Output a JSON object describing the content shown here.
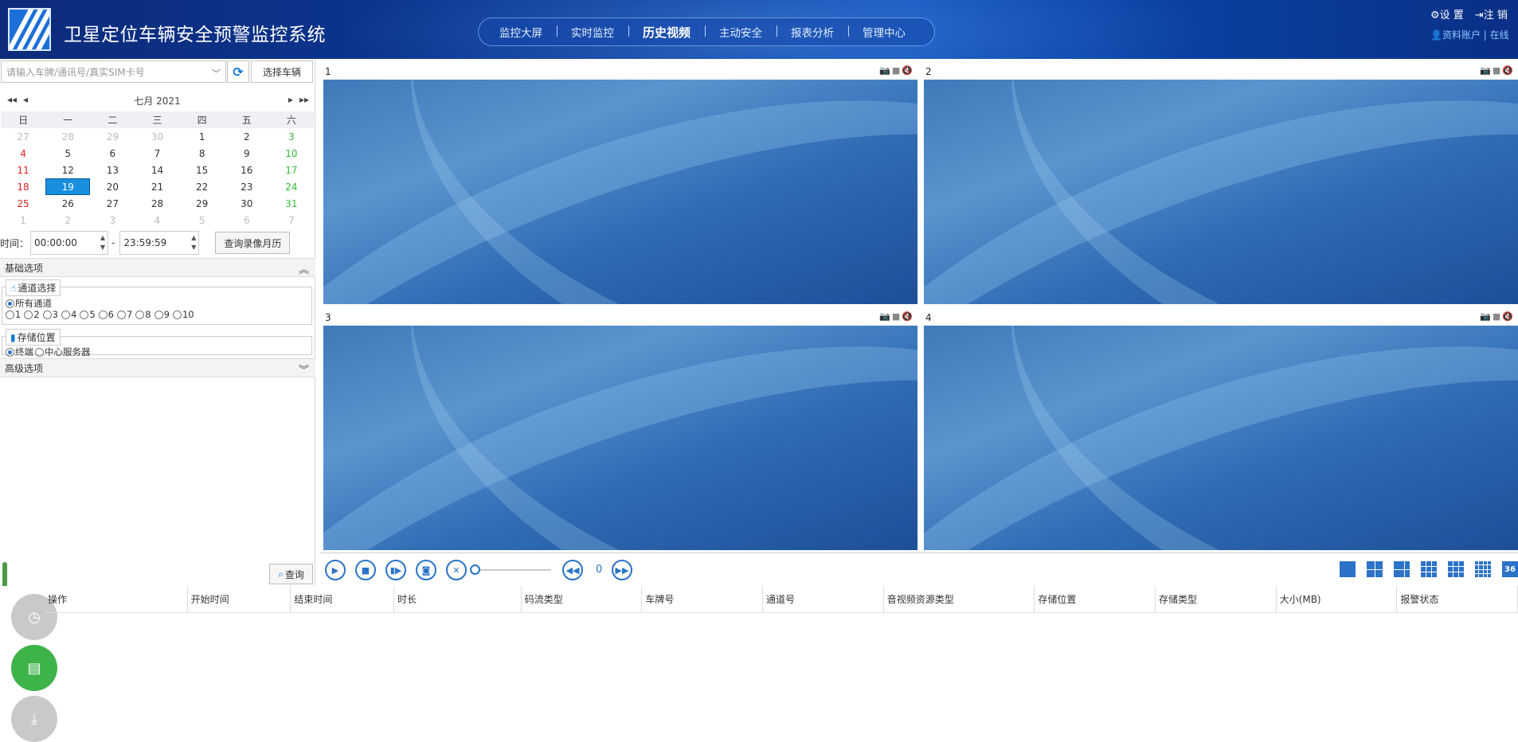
{
  "header": {
    "app_title": "卫星定位车辆安全预警监控系统",
    "nav": [
      {
        "label": "监控大屏"
      },
      {
        "label": "实时监控"
      },
      {
        "label": "历史视频"
      },
      {
        "label": "主动安全"
      },
      {
        "label": "报表分析"
      },
      {
        "label": "管理中心"
      }
    ],
    "active_nav": "历史视频",
    "settings_label": "设 置",
    "logout_label": "注 销",
    "account_label": "资料账户",
    "status_label": "| 在线"
  },
  "search": {
    "placeholder": "请输入车牌/通讯号/真实SIM卡号",
    "select_vehicle": "选择车辆"
  },
  "calendar": {
    "title": "七月 2021",
    "weekdays": [
      "日",
      "一",
      "二",
      "三",
      "四",
      "五",
      "六"
    ],
    "weeks": [
      [
        "27",
        "28",
        "29",
        "30",
        "1",
        "2",
        "3"
      ],
      [
        "4",
        "5",
        "6",
        "7",
        "8",
        "9",
        "10"
      ],
      [
        "11",
        "12",
        "13",
        "14",
        "15",
        "16",
        "17"
      ],
      [
        "18",
        "19",
        "20",
        "21",
        "22",
        "23",
        "24"
      ],
      [
        "25",
        "26",
        "27",
        "28",
        "29",
        "30",
        "31"
      ],
      [
        "1",
        "2",
        "3",
        "4",
        "5",
        "6",
        "7"
      ]
    ],
    "selected": "19"
  },
  "time": {
    "label": "时间：",
    "start": "00:00:00",
    "separator": "-",
    "end": "23:59:59",
    "query_calendar": "查询录像月历"
  },
  "basic": {
    "title": "基础选项",
    "channel_legend": "通道选择",
    "all_channels": "所有通道",
    "channels": [
      "1",
      "2",
      "3",
      "4",
      "5",
      "6",
      "7",
      "8",
      "9",
      "10"
    ],
    "storage_legend": "存储位置",
    "storage_options": [
      "终端",
      "中心服务器"
    ]
  },
  "advanced": {
    "title": "高级选项"
  },
  "query_button": "查询",
  "video": {
    "cells": [
      {
        "label": "1"
      },
      {
        "label": "2"
      },
      {
        "label": "3"
      },
      {
        "label": "4"
      }
    ],
    "speed": "0",
    "layout_max": "36"
  },
  "table": {
    "columns": [
      "操作",
      "开始时间",
      "结束时间",
      "时长",
      "码流类型",
      "车牌号",
      "通道号",
      "音视频资源类型",
      "存储位置",
      "存储类型",
      "大小(MB)",
      "报警状态"
    ]
  },
  "colors": {
    "accent": "#1a8fde",
    "header_bg": "#0d2b7a",
    "green": "#3db34a"
  }
}
